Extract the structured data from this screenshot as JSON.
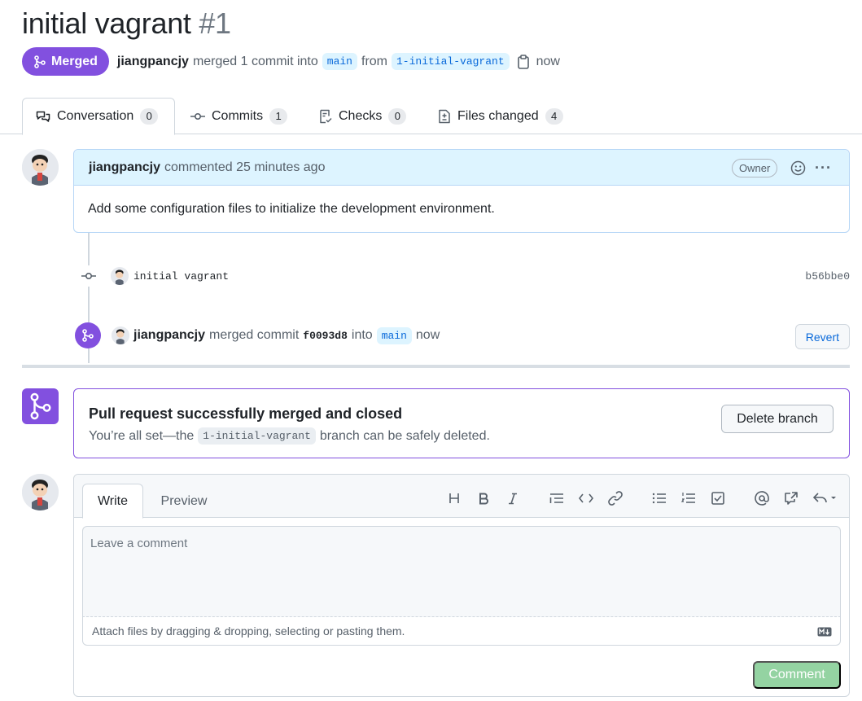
{
  "pr": {
    "title": "initial vagrant",
    "number": "#1",
    "state_label": "Merged",
    "author": "jiangpancjy",
    "merge_text": "merged 1 commit into",
    "base_branch": "main",
    "from_text": "from",
    "head_branch": "1-initial-vagrant",
    "time": "now"
  },
  "tabs": [
    {
      "label": "Conversation",
      "count": "0"
    },
    {
      "label": "Commits",
      "count": "1"
    },
    {
      "label": "Checks",
      "count": "0"
    },
    {
      "label": "Files changed",
      "count": "4"
    }
  ],
  "comment": {
    "author": "jiangpancjy",
    "action": "commented 25 minutes ago",
    "badge": "Owner",
    "body": "Add some configuration files to initialize the development environment."
  },
  "commit": {
    "message": "initial vagrant",
    "sha": "b56bbe0"
  },
  "merge_event": {
    "author": "jiangpancjy",
    "text1": "merged commit",
    "sha": "f0093d8",
    "text2": "into",
    "branch": "main",
    "time": "now",
    "revert_label": "Revert"
  },
  "merged_box": {
    "title": "Pull request successfully merged and closed",
    "sub_before": "You’re all set—the",
    "branch": "1-initial-vagrant",
    "sub_after": "branch can be safely deleted.",
    "delete_label": "Delete branch"
  },
  "editor": {
    "write_tab": "Write",
    "preview_tab": "Preview",
    "placeholder": "Leave a comment",
    "attach_hint": "Attach files by dragging & dropping, selecting or pasting them.",
    "submit_label": "Comment",
    "toolbar": [
      "heading-icon",
      "bold-icon",
      "italic-icon",
      "quote-icon",
      "code-icon",
      "link-icon",
      "unordered-list-icon",
      "ordered-list-icon",
      "task-list-icon",
      "mention-icon",
      "cross-reference-icon",
      "reply-icon"
    ]
  },
  "colors": {
    "merged": "#8250df",
    "link": "#0969da",
    "branch_bg": "#ddf4ff",
    "comment_btn": "#94d3a2"
  }
}
